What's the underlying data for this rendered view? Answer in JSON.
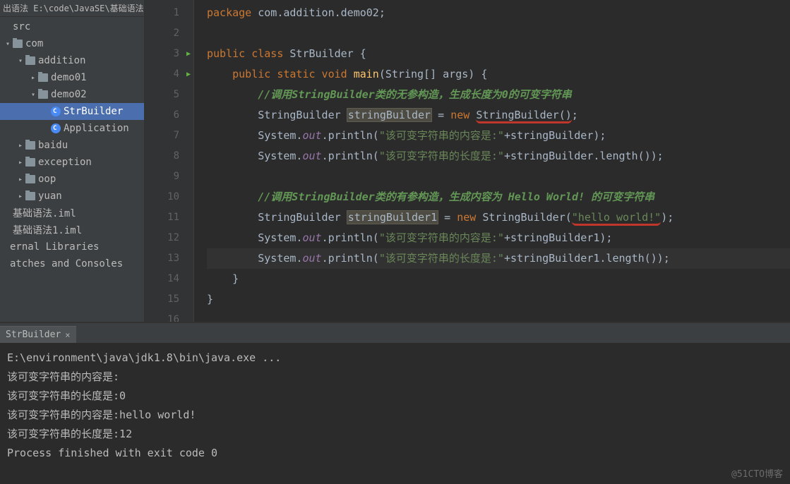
{
  "breadcrumb": "出语法  E:\\code\\JavaSE\\基础语法",
  "tree": {
    "rows": [
      {
        "indent": 0,
        "chev": "",
        "icon": "",
        "label": "src"
      },
      {
        "indent": 0,
        "chev": "▾",
        "icon": "folder",
        "label": "com"
      },
      {
        "indent": 1,
        "chev": "▾",
        "icon": "folder",
        "label": "addition"
      },
      {
        "indent": 2,
        "chev": "▸",
        "icon": "folder",
        "label": "demo01"
      },
      {
        "indent": 2,
        "chev": "▾",
        "icon": "folder",
        "label": "demo02"
      },
      {
        "indent": 3,
        "chev": "",
        "icon": "class",
        "label": "StrBuilder",
        "selected": true
      },
      {
        "indent": 3,
        "chev": "",
        "icon": "class",
        "label": "Application"
      },
      {
        "indent": 1,
        "chev": "▸",
        "icon": "folder",
        "label": "baidu"
      },
      {
        "indent": 1,
        "chev": "▸",
        "icon": "folder",
        "label": "exception"
      },
      {
        "indent": 1,
        "chev": "▸",
        "icon": "folder",
        "label": "oop"
      },
      {
        "indent": 1,
        "chev": "▸",
        "icon": "folder",
        "label": "yuan"
      },
      {
        "indent": 0,
        "chev": "",
        "icon": "",
        "label": "基础语法.iml"
      },
      {
        "indent": 0,
        "chev": "",
        "icon": "",
        "label": "基础语法1.iml"
      },
      {
        "indent": -1,
        "chev": "",
        "icon": "",
        "label": "ernal Libraries"
      },
      {
        "indent": -1,
        "chev": "",
        "icon": "",
        "label": "atches and Consoles"
      }
    ]
  },
  "code": {
    "lines": [
      {
        "n": 1,
        "tokens": [
          [
            "kw",
            "package "
          ],
          [
            "",
            "com.addition.demo02;"
          ]
        ]
      },
      {
        "n": 2,
        "tokens": [
          [
            "",
            ""
          ]
        ]
      },
      {
        "n": 3,
        "run": true,
        "tokens": [
          [
            "kw",
            "public class "
          ],
          [
            "",
            "StrBuilder {"
          ]
        ]
      },
      {
        "n": 4,
        "run": true,
        "tokens": [
          [
            "",
            "    "
          ],
          [
            "kw",
            "public static void "
          ],
          [
            "fn",
            "main"
          ],
          [
            "",
            "(String[] args) {"
          ]
        ]
      },
      {
        "n": 5,
        "tokens": [
          [
            "",
            "        "
          ],
          [
            "cm",
            "//调用StringBuilder类的无参构造，生成长度为0的可变字符串"
          ]
        ]
      },
      {
        "n": 6,
        "tokens": [
          [
            "",
            "        StringBuilder "
          ],
          [
            "box",
            "stringBuilder"
          ],
          [
            "",
            " = "
          ],
          [
            "kw",
            "new "
          ],
          [
            "under-red",
            "StringBuilder()"
          ],
          [
            "",
            ";"
          ]
        ]
      },
      {
        "n": 7,
        "tokens": [
          [
            "",
            "        System."
          ],
          [
            "fld",
            "out"
          ],
          [
            "",
            ".println("
          ],
          [
            "st",
            "\"该可变字符串的内容是:\""
          ],
          [
            "",
            "+stringBuilder);"
          ]
        ]
      },
      {
        "n": 8,
        "tokens": [
          [
            "",
            "        System."
          ],
          [
            "fld",
            "out"
          ],
          [
            "",
            ".println("
          ],
          [
            "st",
            "\"该可变字符串的长度是:\""
          ],
          [
            "",
            "+stringBuilder.length());"
          ]
        ]
      },
      {
        "n": 9,
        "tokens": [
          [
            "",
            ""
          ]
        ]
      },
      {
        "n": 10,
        "tokens": [
          [
            "",
            "        "
          ],
          [
            "cm",
            "//调用StringBuilder类的有参构造，生成内容为 Hello World! 的可变字符串"
          ]
        ]
      },
      {
        "n": 11,
        "tokens": [
          [
            "",
            "        StringBuilder "
          ],
          [
            "box",
            "stringBuilder1"
          ],
          [
            "",
            " = "
          ],
          [
            "kw",
            "new "
          ],
          [
            "",
            "StringBuilder("
          ],
          [
            "under-red st",
            "\"hello world!\""
          ],
          [
            "",
            ");"
          ]
        ]
      },
      {
        "n": 12,
        "tokens": [
          [
            "",
            "        System."
          ],
          [
            "fld",
            "out"
          ],
          [
            "",
            ".println("
          ],
          [
            "st",
            "\"该可变字符串的内容是:\""
          ],
          [
            "",
            "+stringBuilder1);"
          ]
        ]
      },
      {
        "n": 13,
        "hl": true,
        "tokens": [
          [
            "",
            "        System."
          ],
          [
            "fld",
            "out"
          ],
          [
            "",
            ".println("
          ],
          [
            "st",
            "\"该可变字符串的长度是:\""
          ],
          [
            "",
            "+stringBuilder1.length());"
          ]
        ]
      },
      {
        "n": 14,
        "tokens": [
          [
            "",
            "    }"
          ]
        ]
      },
      {
        "n": 15,
        "tokens": [
          [
            "",
            "}"
          ]
        ]
      },
      {
        "n": 16,
        "tokens": [
          [
            "",
            ""
          ]
        ]
      }
    ]
  },
  "tab": {
    "label": "StrBuilder",
    "close": "×"
  },
  "console": {
    "lines": [
      "E:\\environment\\java\\jdk1.8\\bin\\java.exe ...",
      "该可变字符串的内容是:",
      "该可变字符串的长度是:0",
      "该可变字符串的内容是:hello world!",
      "该可变字符串的长度是:12",
      "",
      "Process finished with exit code 0"
    ]
  },
  "watermark": "@51CTO博客"
}
